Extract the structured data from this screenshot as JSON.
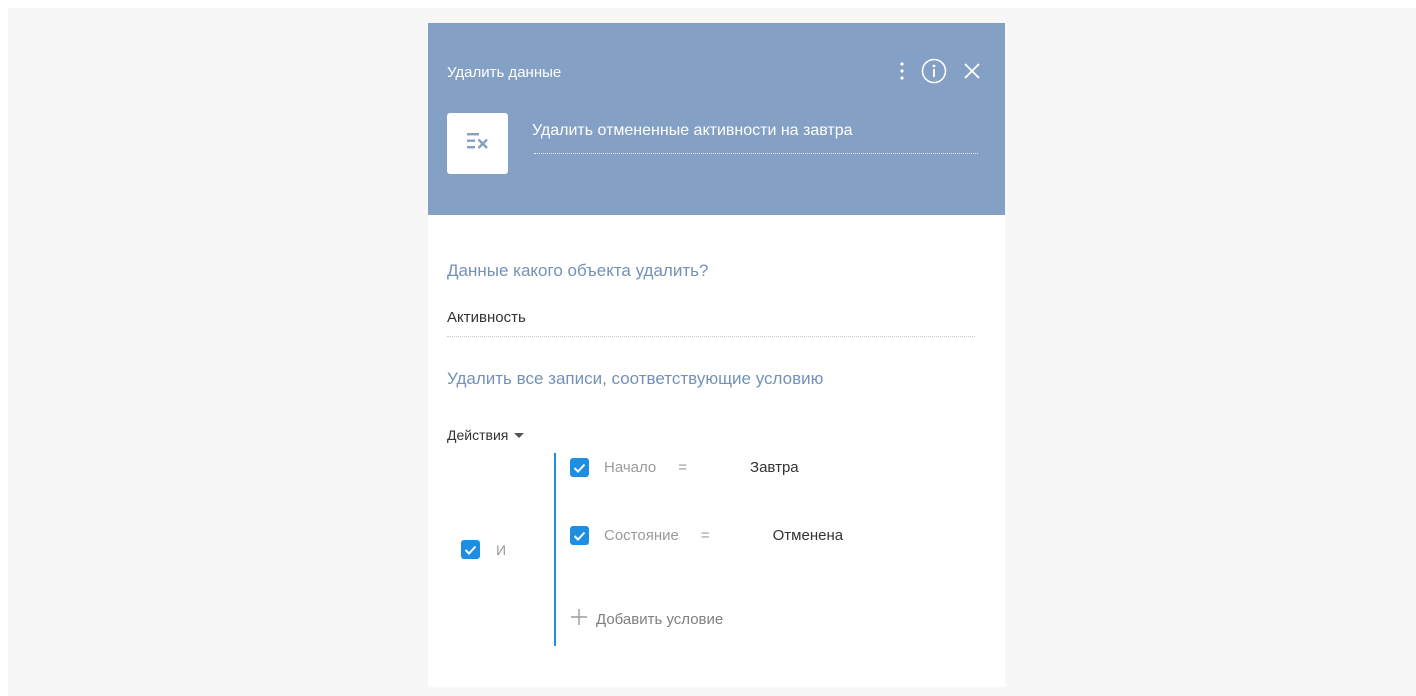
{
  "header": {
    "title": "Удалить данные",
    "element_name": "Удалить отмененные активности на завтра",
    "header_color": "#84a0c4"
  },
  "object_section": {
    "question": "Данные какого объекта удалить?",
    "value": "Активность"
  },
  "filter_section": {
    "title": "Удалить все записи, соответствующие условию",
    "actions_label": "Действия",
    "group_operator": "И",
    "conditions": [
      {
        "column": "Начало",
        "operator": "=",
        "value": "Завтра",
        "checked": true
      },
      {
        "column": "Состояние",
        "operator": "=",
        "value": "Отменена",
        "checked": true
      }
    ],
    "add_condition_label": "Добавить условие"
  },
  "icons": [
    "more-vertical-icon",
    "info-icon",
    "close-icon",
    "delete-data-icon",
    "checkbox-checked-icon",
    "plus-icon",
    "caret-down-icon"
  ],
  "colors": {
    "accent": "#1e8ee0",
    "label": "#7391b8"
  }
}
